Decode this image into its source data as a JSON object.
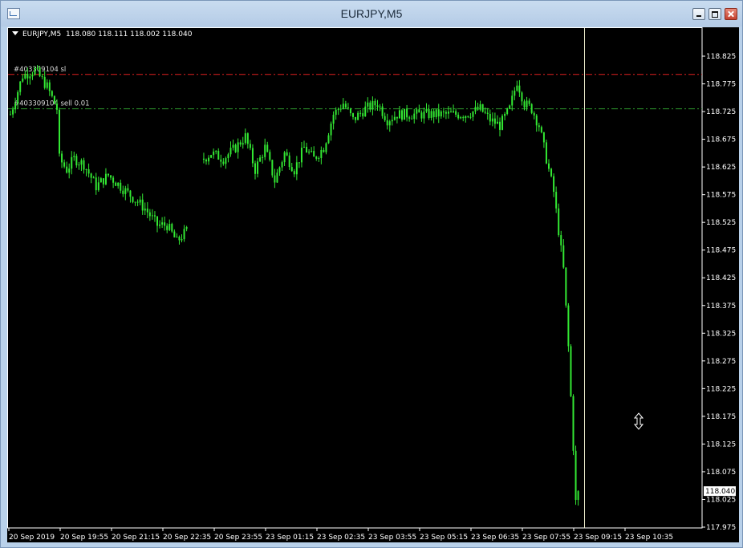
{
  "window": {
    "title": "EURJPY,M5"
  },
  "chart_header": {
    "symbol": "EURJPY,M5",
    "ohlc": "118.080 118.111 118.002 118.040"
  },
  "chart_data": {
    "type": "candlestick",
    "price_axis": {
      "min": 117.975,
      "max": 118.825,
      "ticks": [
        "118.825",
        "118.775",
        "118.725",
        "118.675",
        "118.625",
        "118.575",
        "118.525",
        "118.475",
        "118.425",
        "118.375",
        "118.325",
        "118.275",
        "118.225",
        "118.175",
        "118.125",
        "118.075",
        "118.025",
        "117.975"
      ]
    },
    "time_axis_labels": [
      "20 Sep 2019",
      "20 Sep 19:55",
      "20 Sep 21:15",
      "20 Sep 22:35",
      "20 Sep 23:55",
      "23 Sep 01:15",
      "23 Sep 02:35",
      "23 Sep 03:55",
      "23 Sep 05:15",
      "23 Sep 06:35",
      "23 Sep 07:55",
      "23 Sep 09:15",
      "23 Sep 10:35"
    ],
    "current_price": "118.040",
    "order_lines": [
      {
        "label": "#403309104 sl",
        "price": 118.792,
        "color": "#e02020",
        "style": "dash-dot"
      },
      {
        "label": "#403309104 sell 0.01",
        "price": 118.73,
        "color": "#2e9a2e",
        "style": "dash-dot"
      }
    ],
    "price_path": [
      [
        0,
        118.72
      ],
      [
        5,
        118.79
      ],
      [
        10,
        118.8
      ],
      [
        15,
        118.77
      ],
      [
        19,
        118.73
      ],
      [
        20,
        118.64
      ],
      [
        23,
        118.62
      ],
      [
        26,
        118.64
      ],
      [
        30,
        118.63
      ],
      [
        35,
        118.59
      ],
      [
        40,
        118.61
      ],
      [
        45,
        118.59
      ],
      [
        50,
        118.57
      ],
      [
        55,
        118.55
      ],
      [
        60,
        118.52
      ],
      [
        64,
        118.52
      ],
      [
        68,
        118.49
      ],
      [
        72,
        118.51
      ],
      [
        79,
        118.64
      ],
      [
        82,
        118.65
      ],
      [
        87,
        118.64
      ],
      [
        92,
        118.66
      ],
      [
        96,
        118.68
      ],
      [
        100,
        118.62
      ],
      [
        104,
        118.66
      ],
      [
        108,
        118.6
      ],
      [
        112,
        118.65
      ],
      [
        116,
        118.62
      ],
      [
        120,
        118.66
      ],
      [
        124,
        118.64
      ],
      [
        128,
        118.66
      ],
      [
        132,
        118.72
      ],
      [
        136,
        118.74
      ],
      [
        140,
        118.71
      ],
      [
        145,
        118.73
      ],
      [
        150,
        118.74
      ],
      [
        154,
        118.71
      ],
      [
        158,
        118.72
      ],
      [
        165,
        118.72
      ],
      [
        172,
        118.72
      ],
      [
        178,
        118.72
      ],
      [
        186,
        118.72
      ],
      [
        192,
        118.73
      ],
      [
        196,
        118.71
      ],
      [
        200,
        118.7
      ],
      [
        204,
        118.73
      ],
      [
        207,
        118.78
      ],
      [
        210,
        118.74
      ],
      [
        213,
        118.73
      ],
      [
        216,
        118.7
      ],
      [
        218,
        118.66
      ],
      [
        220,
        118.62
      ],
      [
        222,
        118.58
      ],
      [
        224,
        118.51
      ],
      [
        226,
        118.44
      ],
      [
        228,
        118.3
      ],
      [
        230,
        118.12
      ],
      [
        231,
        118.02
      ],
      [
        232,
        118.04
      ]
    ]
  }
}
